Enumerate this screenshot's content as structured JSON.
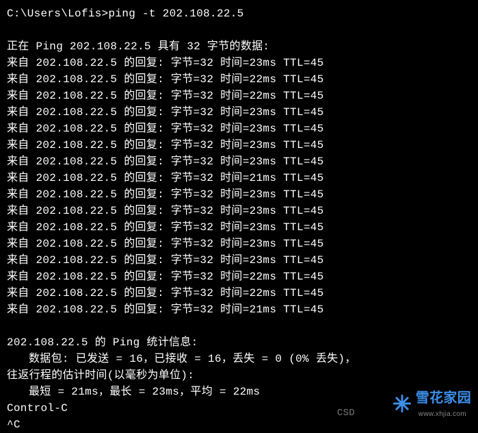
{
  "prompt": "C:\\Users\\Lofis>ping -t 202.108.22.5",
  "header": "正在 Ping 202.108.22.5 具有 32 字节的数据:",
  "ip": "202.108.22.5",
  "replies": [
    {
      "bytes": 32,
      "time": 23,
      "ttl": 45
    },
    {
      "bytes": 32,
      "time": 22,
      "ttl": 45
    },
    {
      "bytes": 32,
      "time": 22,
      "ttl": 45
    },
    {
      "bytes": 32,
      "time": 23,
      "ttl": 45
    },
    {
      "bytes": 32,
      "time": 23,
      "ttl": 45
    },
    {
      "bytes": 32,
      "time": 23,
      "ttl": 45
    },
    {
      "bytes": 32,
      "time": 23,
      "ttl": 45
    },
    {
      "bytes": 32,
      "time": 21,
      "ttl": 45
    },
    {
      "bytes": 32,
      "time": 23,
      "ttl": 45
    },
    {
      "bytes": 32,
      "time": 23,
      "ttl": 45
    },
    {
      "bytes": 32,
      "time": 23,
      "ttl": 45
    },
    {
      "bytes": 32,
      "time": 23,
      "ttl": 45
    },
    {
      "bytes": 32,
      "time": 23,
      "ttl": 45
    },
    {
      "bytes": 32,
      "time": 22,
      "ttl": 45
    },
    {
      "bytes": 32,
      "time": 22,
      "ttl": 45
    },
    {
      "bytes": 32,
      "time": 21,
      "ttl": 45
    }
  ],
  "stats": {
    "title": "202.108.22.5 的 Ping 统计信息:",
    "packets": "数据包: 已发送 = 16，已接收 = 16，丢失 = 0 (0% 丢失)，",
    "rtt_title": "往返行程的估计时间(以毫秒为单位):",
    "rtt_values": "最短 = 21ms，最长 = 23ms，平均 = 22ms"
  },
  "ctrl_c": "Control-C",
  "caret_c": "^C",
  "watermark": {
    "main": "雪花家园",
    "sub": "www.xhjia.com",
    "csdn": "CSD"
  }
}
